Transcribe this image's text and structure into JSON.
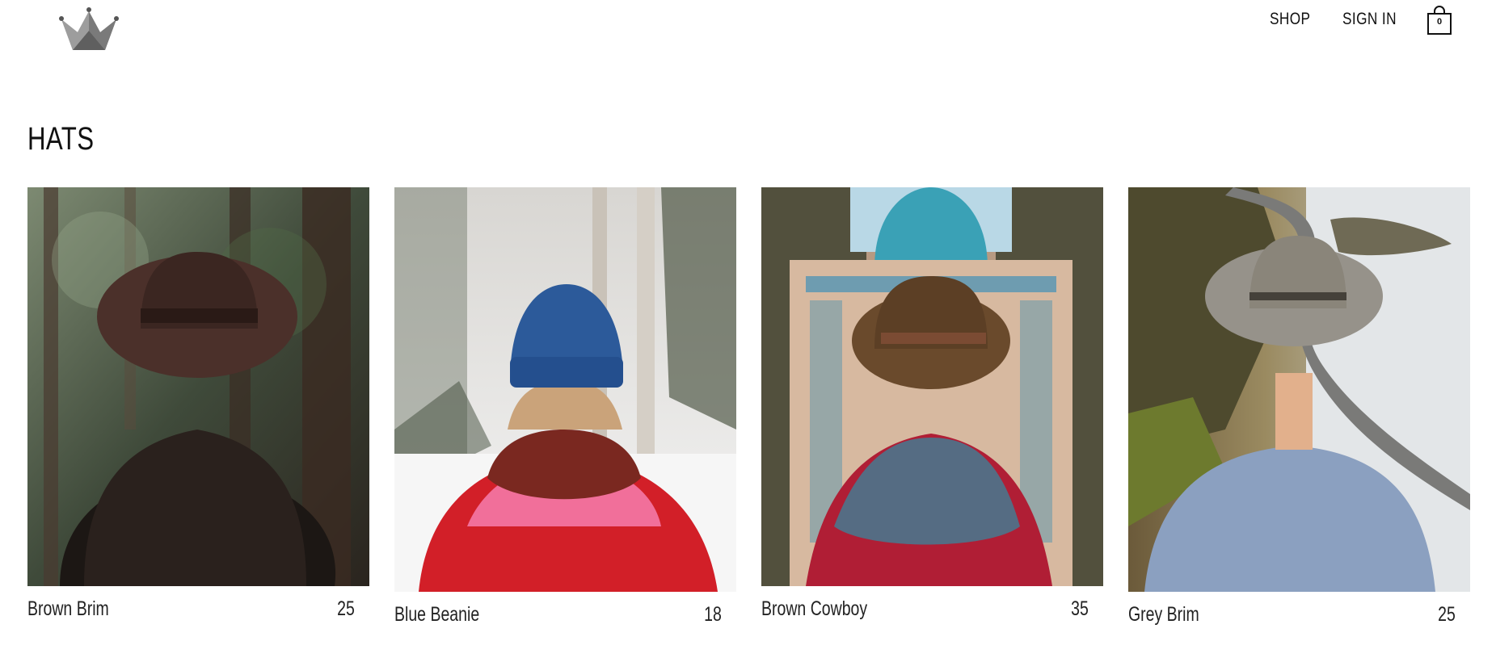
{
  "header": {
    "logo_icon": "crown-icon",
    "nav": [
      {
        "label": "SHOP"
      },
      {
        "label": "SIGN IN"
      }
    ],
    "cart": {
      "icon": "shopping-bag-icon",
      "count": "0"
    }
  },
  "page": {
    "title": "HATS"
  },
  "products": [
    {
      "name": "Brown Brim",
      "price": "25"
    },
    {
      "name": "Blue Beanie",
      "price": "18"
    },
    {
      "name": "Brown Cowboy",
      "price": "35"
    },
    {
      "name": "Grey Brim",
      "price": "25"
    }
  ]
}
